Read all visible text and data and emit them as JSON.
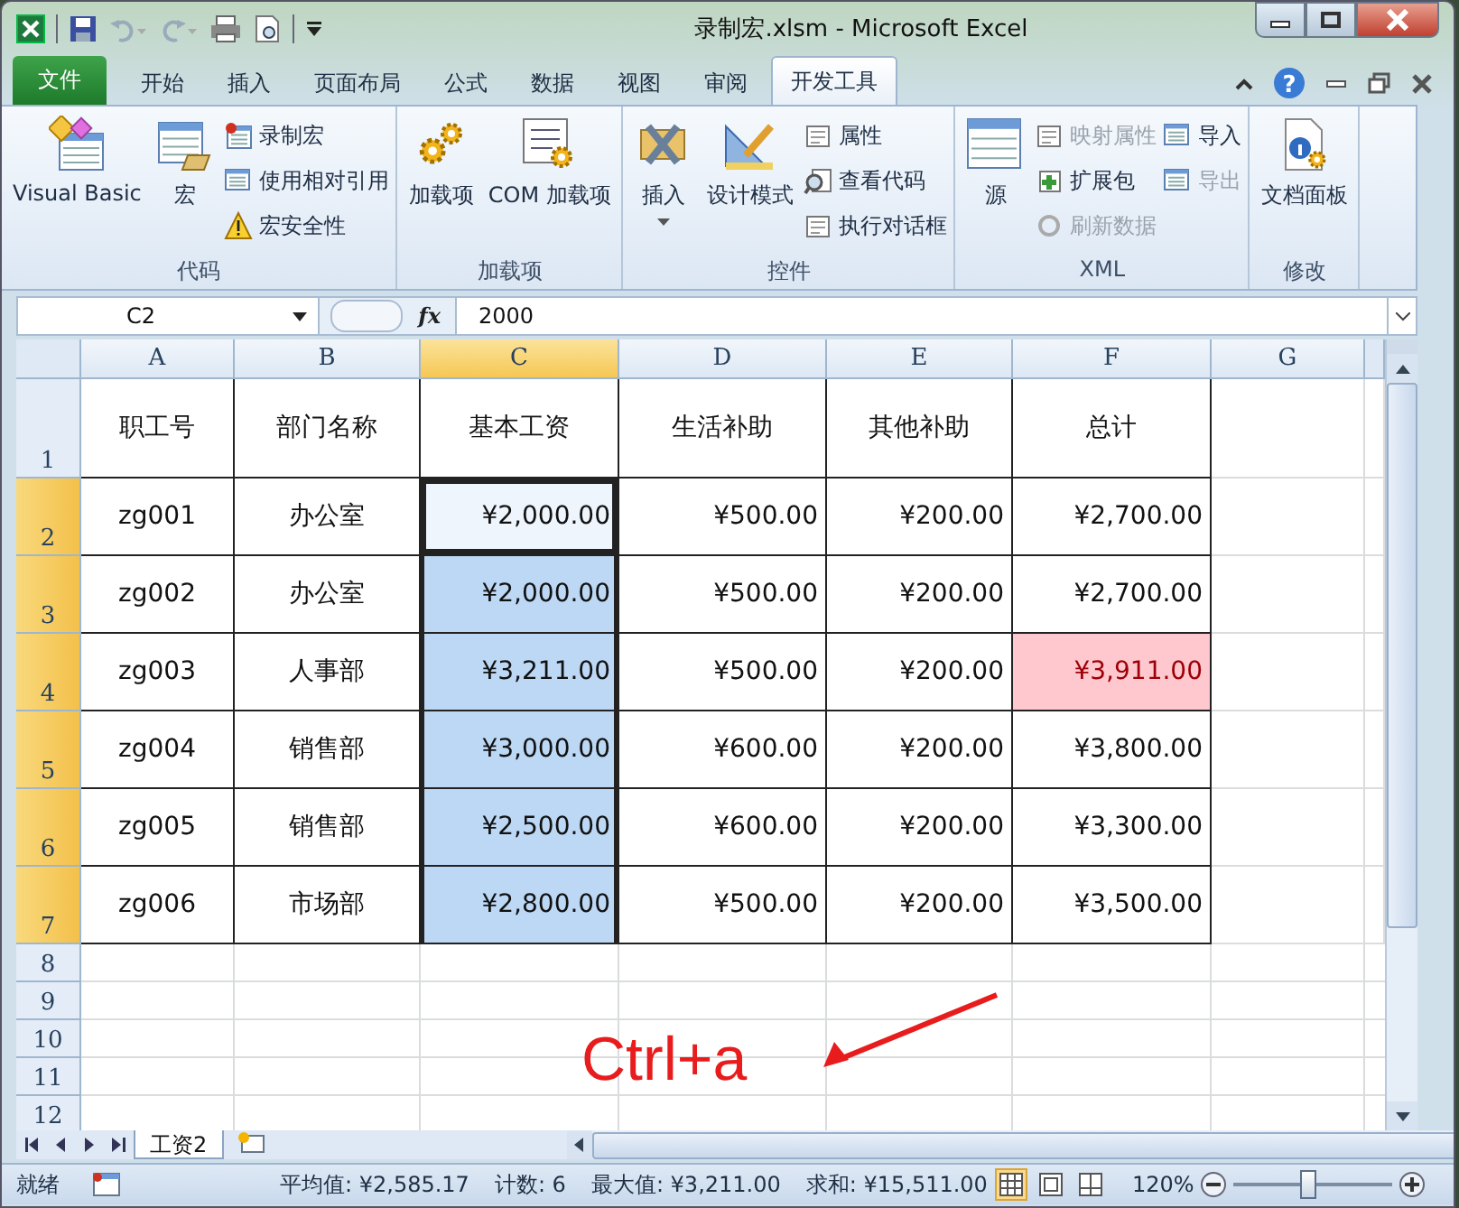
{
  "window": {
    "title": "录制宏.xlsm  -  Microsoft Excel"
  },
  "tabs": [
    {
      "label": "文件",
      "kind": "file",
      "selected": false
    },
    {
      "label": "开始",
      "kind": "tab",
      "selected": false
    },
    {
      "label": "插入",
      "kind": "tab",
      "selected": false
    },
    {
      "label": "页面布局",
      "kind": "tab",
      "selected": false
    },
    {
      "label": "公式",
      "kind": "tab",
      "selected": false
    },
    {
      "label": "数据",
      "kind": "tab",
      "selected": false
    },
    {
      "label": "视图",
      "kind": "tab",
      "selected": false
    },
    {
      "label": "审阅",
      "kind": "tab",
      "selected": false
    },
    {
      "label": "开发工具",
      "kind": "tab",
      "selected": true
    }
  ],
  "ribbon_groups": [
    {
      "label": "代码",
      "items": [
        {
          "label": "Visual Basic",
          "kind": "large",
          "disabled": false
        },
        {
          "label": "宏",
          "kind": "large",
          "disabled": false
        },
        {
          "label": "录制宏",
          "kind": "small",
          "disabled": false
        },
        {
          "label": "使用相对引用",
          "kind": "small",
          "disabled": false
        },
        {
          "label": "宏安全性",
          "kind": "small",
          "disabled": false
        }
      ]
    },
    {
      "label": "加载项",
      "items": [
        {
          "label": "加载项",
          "kind": "large",
          "disabled": false
        },
        {
          "label": "COM 加载项",
          "kind": "large",
          "disabled": false
        }
      ]
    },
    {
      "label": "控件",
      "items": [
        {
          "label": "插入",
          "kind": "dropdown",
          "disabled": false
        },
        {
          "label": "设计模式",
          "kind": "large",
          "disabled": false
        },
        {
          "label": "属性",
          "kind": "small",
          "disabled": false
        },
        {
          "label": "查看代码",
          "kind": "small",
          "disabled": false
        },
        {
          "label": "执行对话框",
          "kind": "small",
          "disabled": false
        }
      ]
    },
    {
      "label": "XML",
      "items": [
        {
          "label": "源",
          "kind": "large",
          "disabled": false
        },
        {
          "label": "映射属性",
          "kind": "small",
          "disabled": true
        },
        {
          "label": "扩展包",
          "kind": "small",
          "disabled": false
        },
        {
          "label": "刷新数据",
          "kind": "small",
          "disabled": true
        },
        {
          "label": "导入",
          "kind": "small",
          "disabled": false
        },
        {
          "label": "导出",
          "kind": "small",
          "disabled": true
        }
      ]
    },
    {
      "label": "修改",
      "items": [
        {
          "label": "文档面板",
          "kind": "large",
          "disabled": false
        }
      ]
    }
  ],
  "help": {
    "label": "?"
  },
  "formula_bar": {
    "name_box": "C2",
    "fx": "fx",
    "value": "2000"
  },
  "sheet": {
    "columns": [
      {
        "label": "A",
        "selected": false
      },
      {
        "label": "B",
        "selected": false
      },
      {
        "label": "C",
        "selected": true
      },
      {
        "label": "D",
        "selected": false
      },
      {
        "label": "E",
        "selected": false
      },
      {
        "label": "F",
        "selected": false
      },
      {
        "label": "G",
        "selected": false
      }
    ],
    "rows": [
      {
        "number": "1",
        "selected": false,
        "cells": [
          {
            "text": "职工号",
            "selected": false,
            "highlighted": false
          },
          {
            "text": "部门名称",
            "selected": false,
            "highlighted": false
          },
          {
            "text": "基本工资",
            "selected": false,
            "highlighted": false
          },
          {
            "text": "生活补助",
            "selected": false,
            "highlighted": false
          },
          {
            "text": "其他补助",
            "selected": false,
            "highlighted": false
          },
          {
            "text": "总计",
            "selected": false,
            "highlighted": false
          }
        ]
      },
      {
        "number": "2",
        "selected": true,
        "cells": [
          {
            "text": "zg001",
            "selected": false,
            "highlighted": false
          },
          {
            "text": "办公室",
            "selected": false,
            "highlighted": false
          },
          {
            "text": "¥2,000.00",
            "selected": true,
            "highlighted": false
          },
          {
            "text": "¥500.00",
            "selected": false,
            "highlighted": false
          },
          {
            "text": "¥200.00",
            "selected": false,
            "highlighted": false
          },
          {
            "text": "¥2,700.00",
            "selected": false,
            "highlighted": false
          }
        ]
      },
      {
        "number": "3",
        "selected": true,
        "cells": [
          {
            "text": "zg002",
            "selected": false,
            "highlighted": false
          },
          {
            "text": "办公室",
            "selected": false,
            "highlighted": false
          },
          {
            "text": "¥2,000.00",
            "selected": true,
            "highlighted": false
          },
          {
            "text": "¥500.00",
            "selected": false,
            "highlighted": false
          },
          {
            "text": "¥200.00",
            "selected": false,
            "highlighted": false
          },
          {
            "text": "¥2,700.00",
            "selected": false,
            "highlighted": false
          }
        ]
      },
      {
        "number": "4",
        "selected": true,
        "cells": [
          {
            "text": "zg003",
            "selected": false,
            "highlighted": false
          },
          {
            "text": "人事部",
            "selected": false,
            "highlighted": false
          },
          {
            "text": "¥3,211.00",
            "selected": true,
            "highlighted": false
          },
          {
            "text": "¥500.00",
            "selected": false,
            "highlighted": false
          },
          {
            "text": "¥200.00",
            "selected": false,
            "highlighted": false
          },
          {
            "text": "¥3,911.00",
            "selected": false,
            "highlighted": true
          }
        ]
      },
      {
        "number": "5",
        "selected": true,
        "cells": [
          {
            "text": "zg004",
            "selected": false,
            "highlighted": false
          },
          {
            "text": "销售部",
            "selected": false,
            "highlighted": false
          },
          {
            "text": "¥3,000.00",
            "selected": true,
            "highlighted": false
          },
          {
            "text": "¥600.00",
            "selected": false,
            "highlighted": false
          },
          {
            "text": "¥200.00",
            "selected": false,
            "highlighted": false
          },
          {
            "text": "¥3,800.00",
            "selected": false,
            "highlighted": false
          }
        ]
      },
      {
        "number": "6",
        "selected": true,
        "cells": [
          {
            "text": "zg005",
            "selected": false,
            "highlighted": false
          },
          {
            "text": "销售部",
            "selected": false,
            "highlighted": false
          },
          {
            "text": "¥2,500.00",
            "selected": true,
            "highlighted": false
          },
          {
            "text": "¥600.00",
            "selected": false,
            "highlighted": false
          },
          {
            "text": "¥200.00",
            "selected": false,
            "highlighted": false
          },
          {
            "text": "¥3,300.00",
            "selected": false,
            "highlighted": false
          }
        ]
      },
      {
        "number": "7",
        "selected": true,
        "cells": [
          {
            "text": "zg006",
            "selected": false,
            "highlighted": false
          },
          {
            "text": "市场部",
            "selected": false,
            "highlighted": false
          },
          {
            "text": "¥2,800.00",
            "selected": true,
            "highlighted": false
          },
          {
            "text": "¥500.00",
            "selected": false,
            "highlighted": false
          },
          {
            "text": "¥200.00",
            "selected": false,
            "highlighted": false
          },
          {
            "text": "¥3,500.00",
            "selected": false,
            "highlighted": false
          }
        ]
      },
      {
        "number": "8",
        "selected": false
      },
      {
        "number": "9",
        "selected": false
      },
      {
        "number": "10",
        "selected": false
      },
      {
        "number": "11",
        "selected": false
      },
      {
        "number": "12",
        "selected": false
      }
    ]
  },
  "annotation": {
    "text": "Ctrl+a"
  },
  "sheet_tabs": [
    {
      "label": "工资2",
      "selected": true
    }
  ],
  "status_bar": {
    "ready": "就绪",
    "stats": [
      "平均值: ¥2,585.17",
      "计数: 6",
      "最大值: ¥3,211.00",
      "求和: ¥15,511.00"
    ],
    "views": [
      {
        "selected": true
      },
      {
        "selected": false
      },
      {
        "selected": false
      }
    ],
    "zoom": {
      "reading": "120%",
      "level": 0.45
    }
  }
}
